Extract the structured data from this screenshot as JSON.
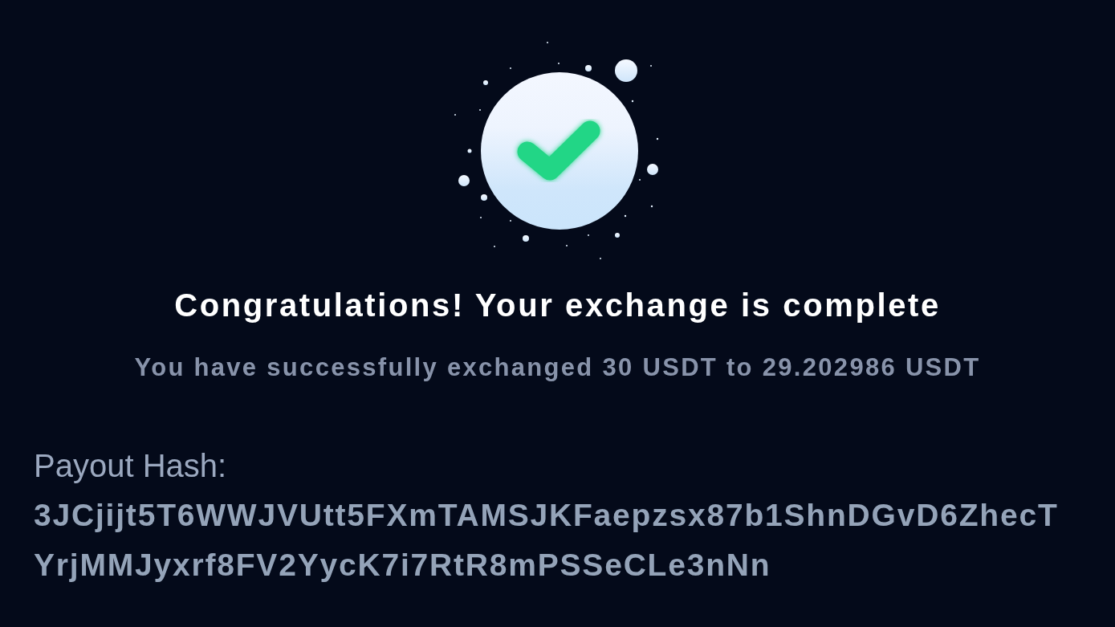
{
  "success": {
    "title": "Congratulations! Your exchange is complete",
    "message": "You have successfully exchanged 30 USDT to 29.202986 USDT"
  },
  "payout": {
    "label": "Payout Hash:",
    "hash": "3JCjijt5T6WWJVUtt5FXmTAMSJKFaepzsx87b1ShnDGvD6ZhecTYrjMMJyxrf8FV2YycK7i7RtR8mPSSeCLe3nNn"
  }
}
